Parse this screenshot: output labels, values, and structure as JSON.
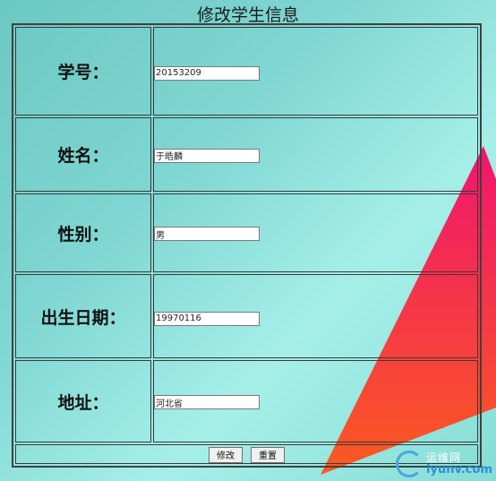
{
  "page": {
    "title": "修改学生信息"
  },
  "form": {
    "rows": [
      {
        "label": "学号：",
        "value": "20153209"
      },
      {
        "label": "姓名：",
        "value": "于皓麟"
      },
      {
        "label": "性别：",
        "value": "男"
      },
      {
        "label": "出生日期：",
        "value": "19970116"
      },
      {
        "label": "地址：",
        "value": "河北省"
      }
    ],
    "submit_label": "修改",
    "reset_label": "重置"
  },
  "watermark": {
    "brand": "运维网",
    "domain": "iyunv.com"
  },
  "colors": {
    "background": "#7fd6d2",
    "triangle_top": "#f0156e",
    "triangle_bottom": "#fb5a20"
  }
}
